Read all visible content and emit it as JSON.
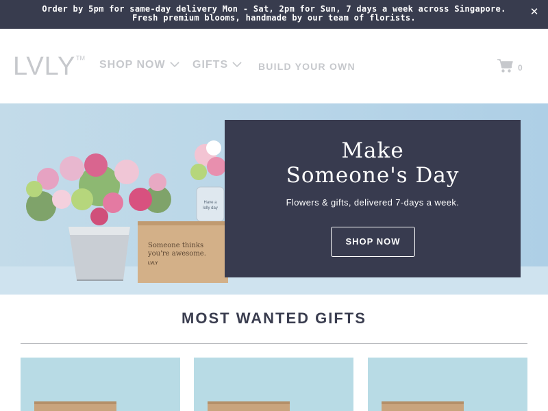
{
  "announcement": {
    "line1": "Order by 5pm for same-day delivery Mon - Sat, 2pm for Sun, 7 days a week across Singapore.",
    "line2": "Fresh premium blooms, handmade by our team of florists.",
    "close_label": "✕"
  },
  "header": {
    "logo_text": "LVLY",
    "logo_tm": "TM",
    "nav": {
      "shop_now": "SHOP NOW",
      "gifts": "GIFTS",
      "build_your_own": "BUILD YOUR OWN"
    },
    "cart_count": "0",
    "icons": {
      "cart": "shopping-cart-icon",
      "chevron": "chevron-down-icon"
    }
  },
  "hero": {
    "title_line1": "Make",
    "title_line2": "Someone's Day",
    "subtitle": "Flowers & gifts, delivered 7-days a week.",
    "button_label": "SHOP NOW",
    "box_text_line1": "Someone thinks",
    "box_text_line2": "you're awesome.",
    "box_brand": "LVLY",
    "jar_text_line1": "Have a",
    "jar_text_line2": "lolly day"
  },
  "section": {
    "title": "MOST WANTED GIFTS"
  },
  "colors": {
    "announcement_bg": "#383c4e",
    "panel_bg": "#383b4f",
    "nav_text": "#c6c8cc",
    "card_bg": "#b8dbe5"
  }
}
